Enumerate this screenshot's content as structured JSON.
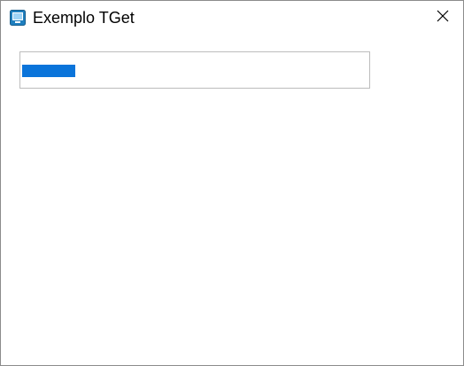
{
  "window": {
    "title": "Exemplo TGet",
    "app_icon": "monitor-icon",
    "close_icon": "close-icon"
  },
  "progress_bar": {
    "value_fraction": 0.155,
    "fill_color": "#0a74da",
    "border_color": "#bcbcbc"
  }
}
